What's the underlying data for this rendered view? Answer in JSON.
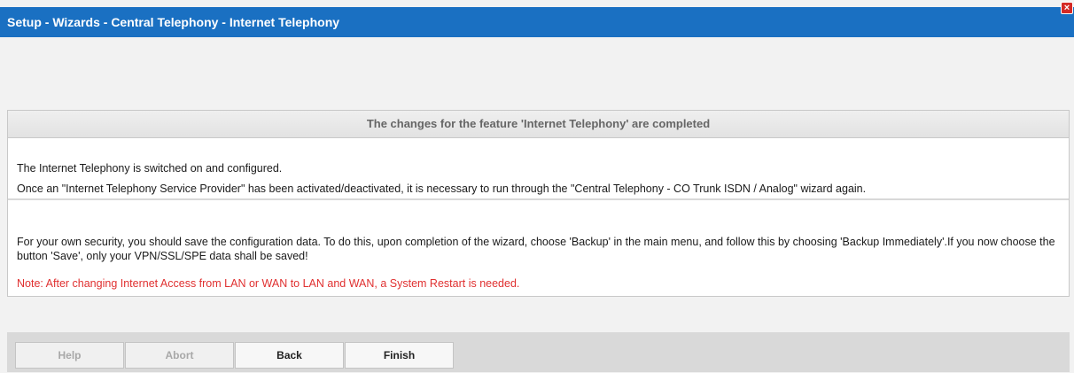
{
  "window": {
    "title": "Setup - Wizards - Central Telephony - Internet Telephony",
    "close_label": "×"
  },
  "header": {
    "text": "The changes for the feature 'Internet Telephony' are completed"
  },
  "info": {
    "line1": "The Internet Telephony is switched on and configured.",
    "line2": "Once an \"Internet Telephony Service Provider\" has been activated/deactivated, it is necessary to run through the \"Central Telephony - CO Trunk ISDN / Analog\" wizard again."
  },
  "security": {
    "paragraph": "For your own security, you should save the configuration data. To do this, upon completion of the wizard, choose 'Backup' in the main menu, and follow this by choosing 'Backup Immediately'.If you now choose the button 'Save', only your VPN/SSL/SPE data shall be saved!",
    "note": "Note: After changing Internet Access from LAN or WAN to LAN and WAN, a System Restart is needed."
  },
  "buttons": {
    "help": "Help",
    "abort": "Abort",
    "back": "Back",
    "finish": "Finish"
  },
  "colors": {
    "titlebar": "#1a70c2",
    "note": "#e03030",
    "close": "#d42a26"
  }
}
